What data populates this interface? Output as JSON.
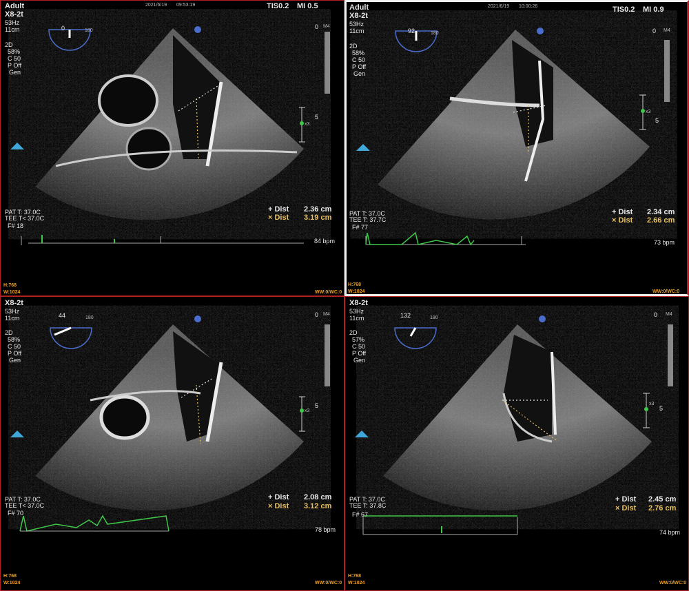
{
  "panels": [
    {
      "header": {
        "top_label": "Adult",
        "probe": "X8-2t",
        "freq": "53Hz",
        "depth": "11cm",
        "date": "2021/6/19",
        "time": "09:53:19",
        "tis": "TIS0.2",
        "mi": "MI 0.5"
      },
      "angle": "0",
      "angle_max": "180",
      "settings": [
        "2D",
        "58%",
        "C 50",
        "P Off",
        "Gen"
      ],
      "depth_scale": {
        "top": "0",
        "mid": "5",
        "map": "M4"
      },
      "temps": [
        "PAT T: 37.0C",
        "TEE T< 37.0C"
      ],
      "frame": "F# 18",
      "measurements": [
        {
          "label": "Dist",
          "value": "2.36 cm"
        },
        {
          "label": "Dist",
          "value": "3.19 cm"
        }
      ],
      "bpm": "84 bpm",
      "hw": [
        "H:768",
        "W:1024"
      ],
      "wwc": "WW:0/WC:0",
      "zoom": "x3"
    },
    {
      "header": {
        "top_label": "Adult",
        "probe": "X8-2t",
        "freq": "53Hz",
        "depth": "11cm",
        "date": "2021/6/19",
        "time": "10:00:26",
        "tis": "TIS0.2",
        "mi": "MI 0.9"
      },
      "angle": "92",
      "angle_max": "180",
      "settings": [
        "2D",
        "58%",
        "C 50",
        "P Off",
        "Gen"
      ],
      "depth_scale": {
        "top": "0",
        "mid": "5",
        "map": "M4"
      },
      "temps": [
        "PAT T: 37.0C",
        "TEE T: 37.7C"
      ],
      "frame": "F# 77",
      "measurements": [
        {
          "label": "Dist",
          "value": "2.34 cm"
        },
        {
          "label": "Dist",
          "value": "2.66 cm"
        }
      ],
      "bpm": "73 bpm",
      "hw": [
        "H:768",
        "W:1024"
      ],
      "wwc": "WW:0/WC:0",
      "zoom": "x3"
    },
    {
      "header": {
        "top_label": "",
        "probe": "X8-2t",
        "freq": "53Hz",
        "depth": "11cm",
        "date": "",
        "time": "",
        "tis": "",
        "mi": ""
      },
      "angle": "44",
      "angle_max": "180",
      "settings": [
        "2D",
        "58%",
        "C 50",
        "P Off",
        "Gen"
      ],
      "depth_scale": {
        "top": "0",
        "mid": "5",
        "map": "M4"
      },
      "temps": [
        "PAT T: 37.0C",
        "TEE T< 37.0C"
      ],
      "frame": "F# 70",
      "measurements": [
        {
          "label": "Dist",
          "value": "2.08 cm"
        },
        {
          "label": "Dist",
          "value": "3.12 cm"
        }
      ],
      "bpm": "78 bpm",
      "hw": [
        "H:768",
        "W:1024"
      ],
      "wwc": "WW:0/WC:0",
      "zoom": "x3"
    },
    {
      "header": {
        "top_label": "",
        "probe": "X8-2t",
        "freq": "53Hz",
        "depth": "11cm",
        "date": "",
        "time": "",
        "tis": "",
        "mi": ""
      },
      "angle": "132",
      "angle_max": "180",
      "settings": [
        "2D",
        "57%",
        "C 50",
        "P Off",
        "Gen"
      ],
      "depth_scale": {
        "top": "0",
        "mid": "5",
        "map": "M4"
      },
      "temps": [
        "PAT T: 37.0C",
        "TEE T: 37.8C"
      ],
      "frame": "F# 67",
      "measurements": [
        {
          "label": "Dist",
          "value": "2.45 cm"
        },
        {
          "label": "Dist",
          "value": "2.76 cm"
        }
      ],
      "bpm": "74 bpm",
      "hw": [
        "H:768",
        "W:1024"
      ],
      "wwc": "WW:0/WC:0",
      "zoom": "x3"
    }
  ],
  "colors": {
    "border": "#b02020",
    "measure_alt": "#e8c060",
    "ecg": "#3fc84a",
    "overlay_text": "#e8e8e8",
    "hw_text": "#f0a020"
  }
}
